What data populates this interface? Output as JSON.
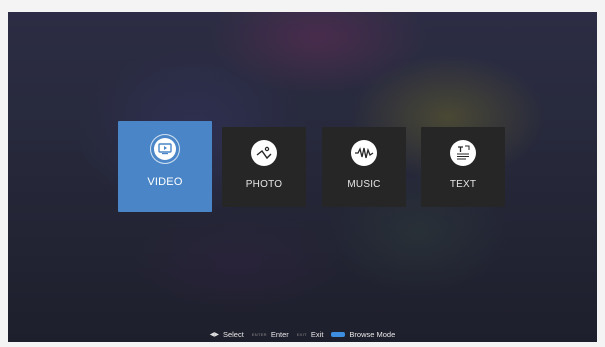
{
  "menu": {
    "items": [
      {
        "id": "video",
        "label": "VIDEO",
        "icon": "video-play-icon",
        "selected": true
      },
      {
        "id": "photo",
        "label": "PHOTO",
        "icon": "photo-landscape-icon",
        "selected": false
      },
      {
        "id": "music",
        "label": "MUSIC",
        "icon": "music-wave-icon",
        "selected": false
      },
      {
        "id": "text",
        "label": "TEXT",
        "icon": "text-document-icon",
        "selected": false
      }
    ]
  },
  "footer": {
    "select_icon": "left-right-arrows-icon",
    "select_label": "Select",
    "enter_key": "ENTER",
    "enter_label": "Enter",
    "exit_key": "EXIT",
    "exit_label": "Exit",
    "browse_key_color": "#3d8de0",
    "browse_label": "Browse Mode"
  },
  "colors": {
    "selected_card": "#4a86c7",
    "card": "#262626"
  }
}
